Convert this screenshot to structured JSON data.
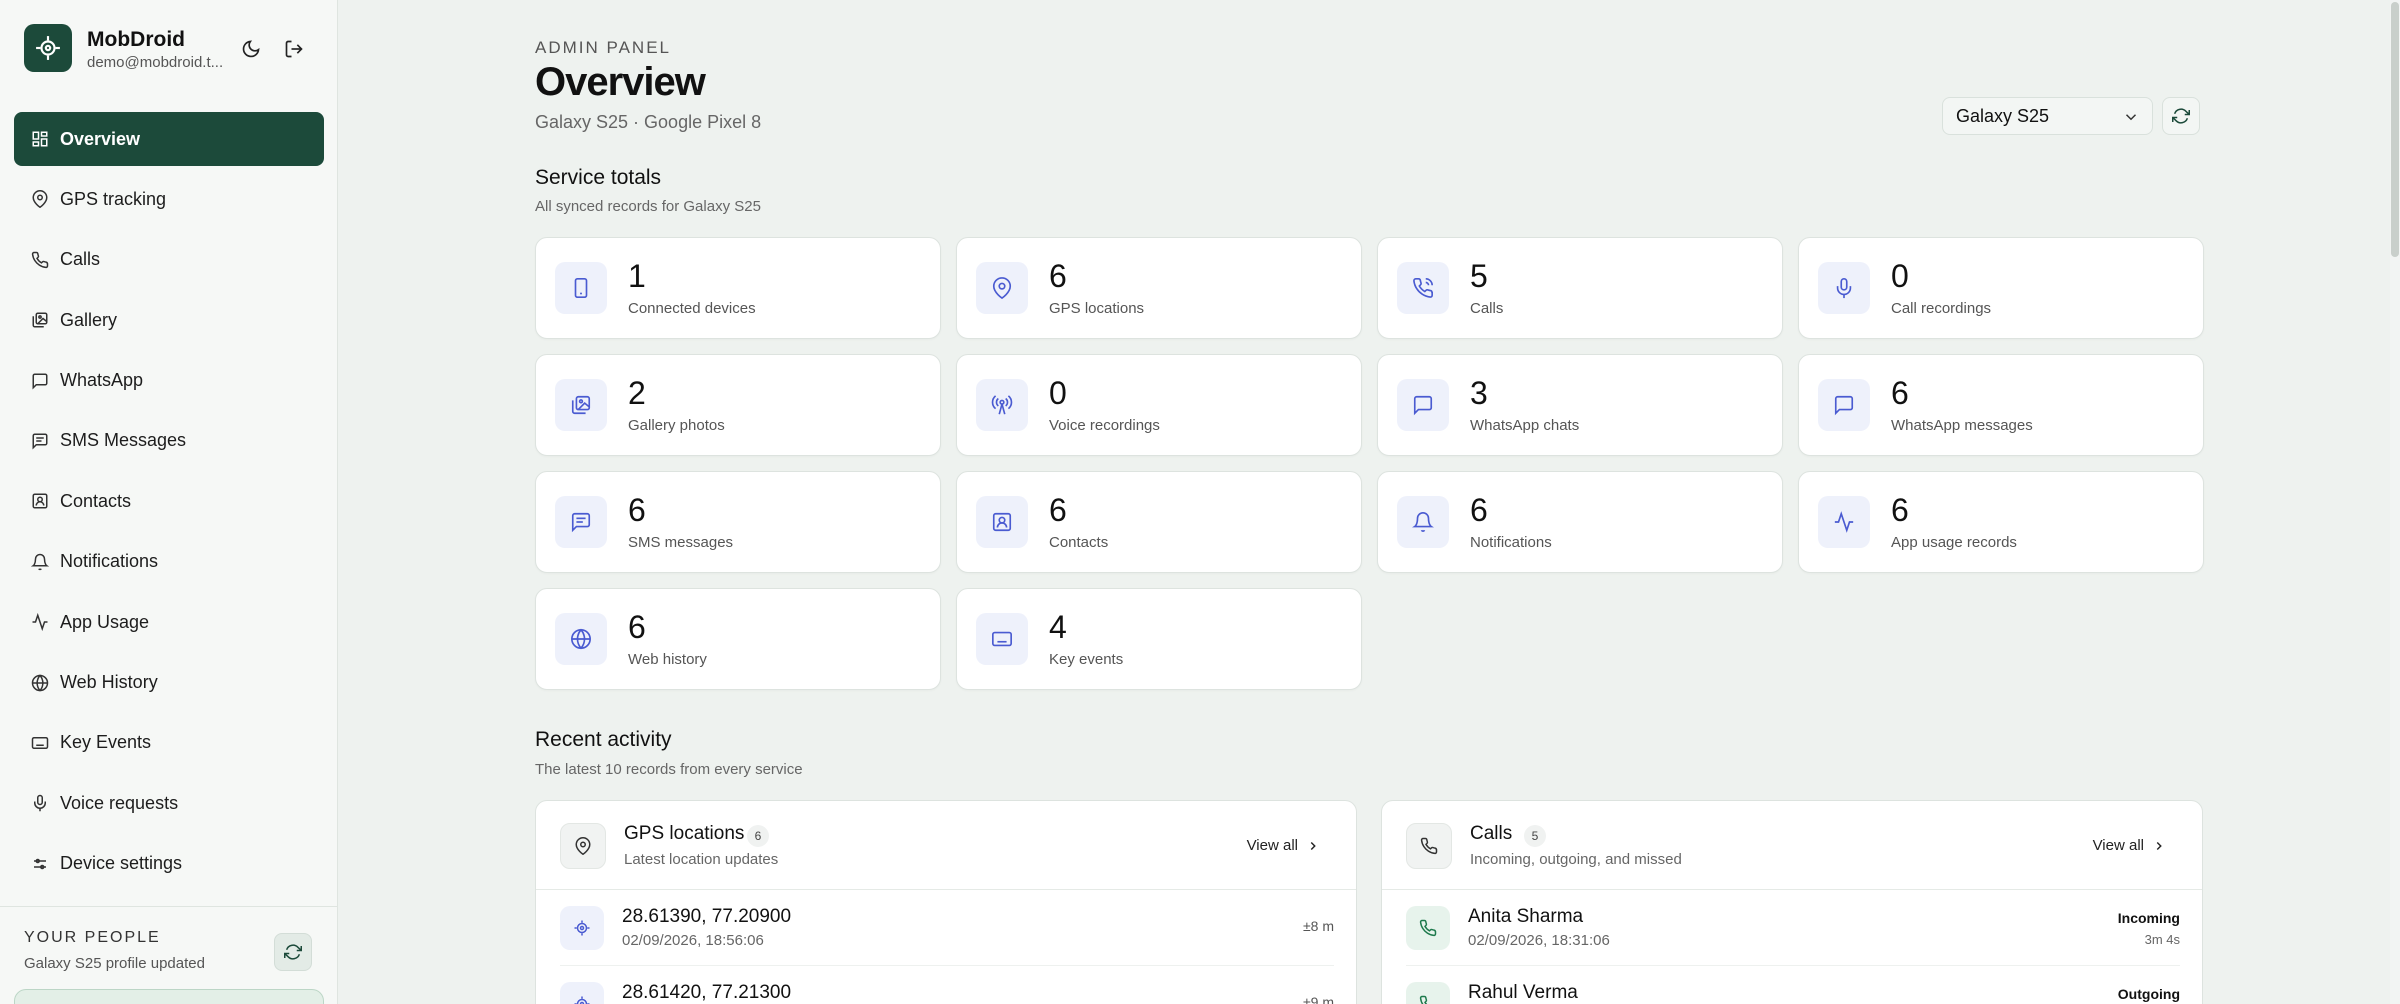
{
  "brand": {
    "name": "MobDroid",
    "email": "demo@mobdroid.t..."
  },
  "nav": [
    {
      "label": "Overview",
      "icon": "grid-icon",
      "active": true
    },
    {
      "label": "GPS tracking",
      "icon": "map-pin-icon"
    },
    {
      "label": "Calls",
      "icon": "phone-icon"
    },
    {
      "label": "Gallery",
      "icon": "gallery-icon"
    },
    {
      "label": "WhatsApp",
      "icon": "chat-icon"
    },
    {
      "label": "SMS Messages",
      "icon": "message-icon"
    },
    {
      "label": "Contacts",
      "icon": "contact-icon"
    },
    {
      "label": "Notifications",
      "icon": "bell-icon"
    },
    {
      "label": "App Usage",
      "icon": "activity-icon"
    },
    {
      "label": "Web History",
      "icon": "globe-icon"
    },
    {
      "label": "Key Events",
      "icon": "keyboard-icon"
    },
    {
      "label": "Voice requests",
      "icon": "mic-icon"
    },
    {
      "label": "Device settings",
      "icon": "sliders-icon"
    }
  ],
  "your_people": {
    "title": "YOUR PEOPLE",
    "subtitle": "Galaxy S25 profile updated"
  },
  "header": {
    "eyebrow": "ADMIN PANEL",
    "title": "Overview",
    "subtitle": "Galaxy S25 · Google Pixel 8",
    "device_selected": "Galaxy S25"
  },
  "service_totals": {
    "title": "Service totals",
    "subtitle": "All synced records for Galaxy S25",
    "cards": [
      {
        "value": "1",
        "label": "Connected devices",
        "icon": "smartphone-icon"
      },
      {
        "value": "6",
        "label": "GPS locations",
        "icon": "map-pin-icon"
      },
      {
        "value": "5",
        "label": "Calls",
        "icon": "phone-icon"
      },
      {
        "value": "0",
        "label": "Call recordings",
        "icon": "mic-icon"
      },
      {
        "value": "2",
        "label": "Gallery photos",
        "icon": "gallery-icon"
      },
      {
        "value": "0",
        "label": "Voice recordings",
        "icon": "broadcast-icon"
      },
      {
        "value": "3",
        "label": "WhatsApp chats",
        "icon": "chat-icon"
      },
      {
        "value": "6",
        "label": "WhatsApp messages",
        "icon": "chat-icon"
      },
      {
        "value": "6",
        "label": "SMS messages",
        "icon": "message-icon"
      },
      {
        "value": "6",
        "label": "Contacts",
        "icon": "contact-icon"
      },
      {
        "value": "6",
        "label": "Notifications",
        "icon": "bell-icon"
      },
      {
        "value": "6",
        "label": "App usage records",
        "icon": "activity-icon"
      },
      {
        "value": "6",
        "label": "Web history",
        "icon": "globe-icon"
      },
      {
        "value": "4",
        "label": "Key events",
        "icon": "keyboard-icon"
      }
    ]
  },
  "recent_activity": {
    "title": "Recent activity",
    "subtitle": "The latest 10 records from every service",
    "gps": {
      "title": "GPS locations",
      "count": "6",
      "subtitle": "Latest location updates",
      "link": "View all",
      "rows": [
        {
          "title": "28.61390, 77.20900",
          "sub": "02/09/2026, 18:56:06",
          "right": "±8 m"
        },
        {
          "title": "28.61420, 77.21300",
          "sub": "",
          "right": "±9 m"
        }
      ]
    },
    "calls": {
      "title": "Calls",
      "count": "5",
      "subtitle": "Incoming, outgoing, and missed",
      "link": "View all",
      "rows": [
        {
          "title": "Anita Sharma",
          "sub": "02/09/2026, 18:31:06",
          "right": "Incoming",
          "right2": "3m 4s"
        },
        {
          "title": "Rahul Verma",
          "sub": "",
          "right": "Outgoing",
          "right2": ""
        }
      ]
    }
  },
  "colors": {
    "accent": "#1c4a3a",
    "icon_blue": "#4a5bd1",
    "bg": "#eef2ef"
  }
}
